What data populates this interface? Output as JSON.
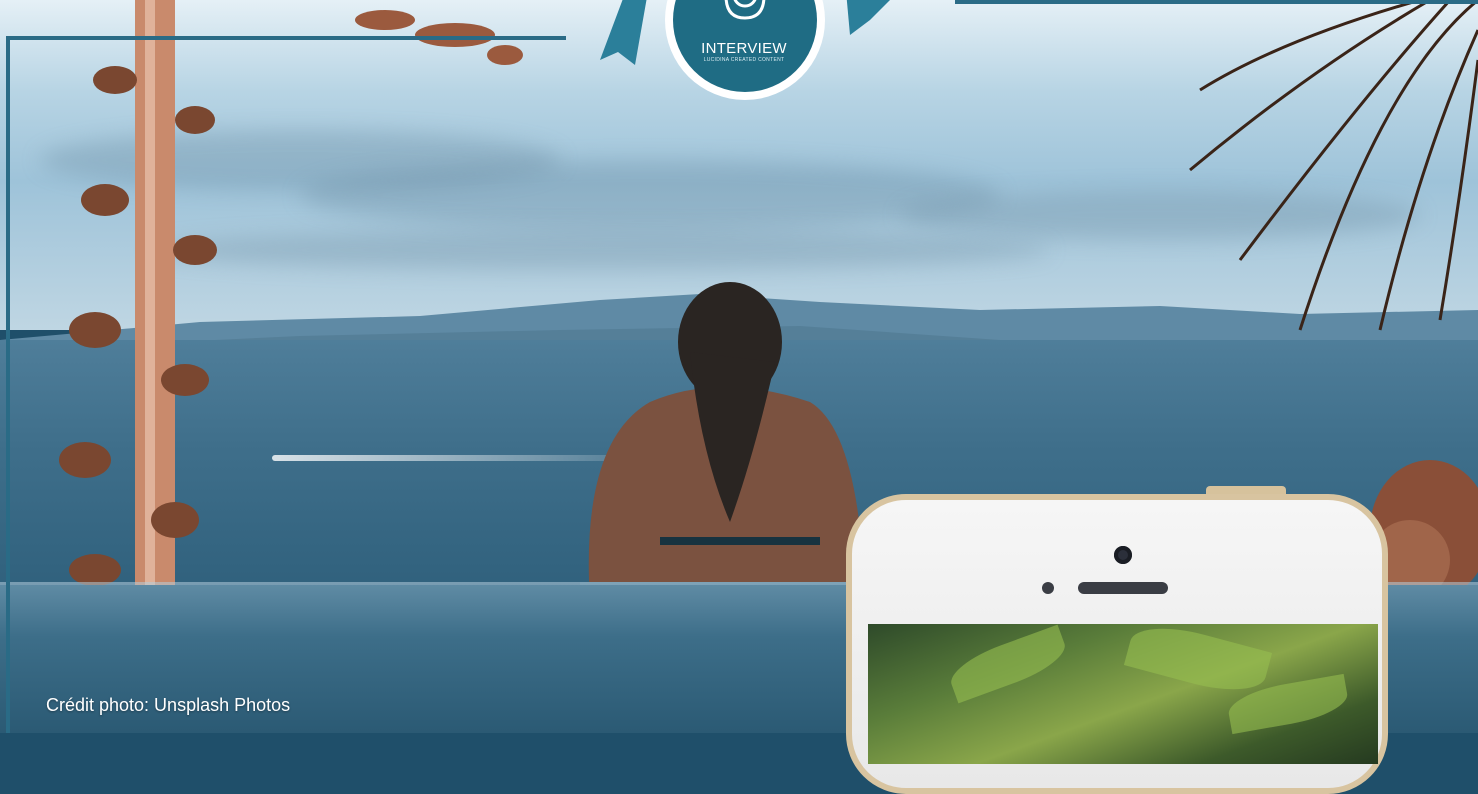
{
  "badge": {
    "label": "INTERVIEW",
    "sublabel": "LUCIDINA CREATED CONTENT",
    "icon": "microphone-icon"
  },
  "photo_credit": "Crédit photo: Unsplash Photos",
  "colors": {
    "frame": "#2a6b86",
    "badge_fill": "#1f6c84",
    "badge_ribbon": "#2b7f9a",
    "phone_frame": "#d8c4a0"
  }
}
